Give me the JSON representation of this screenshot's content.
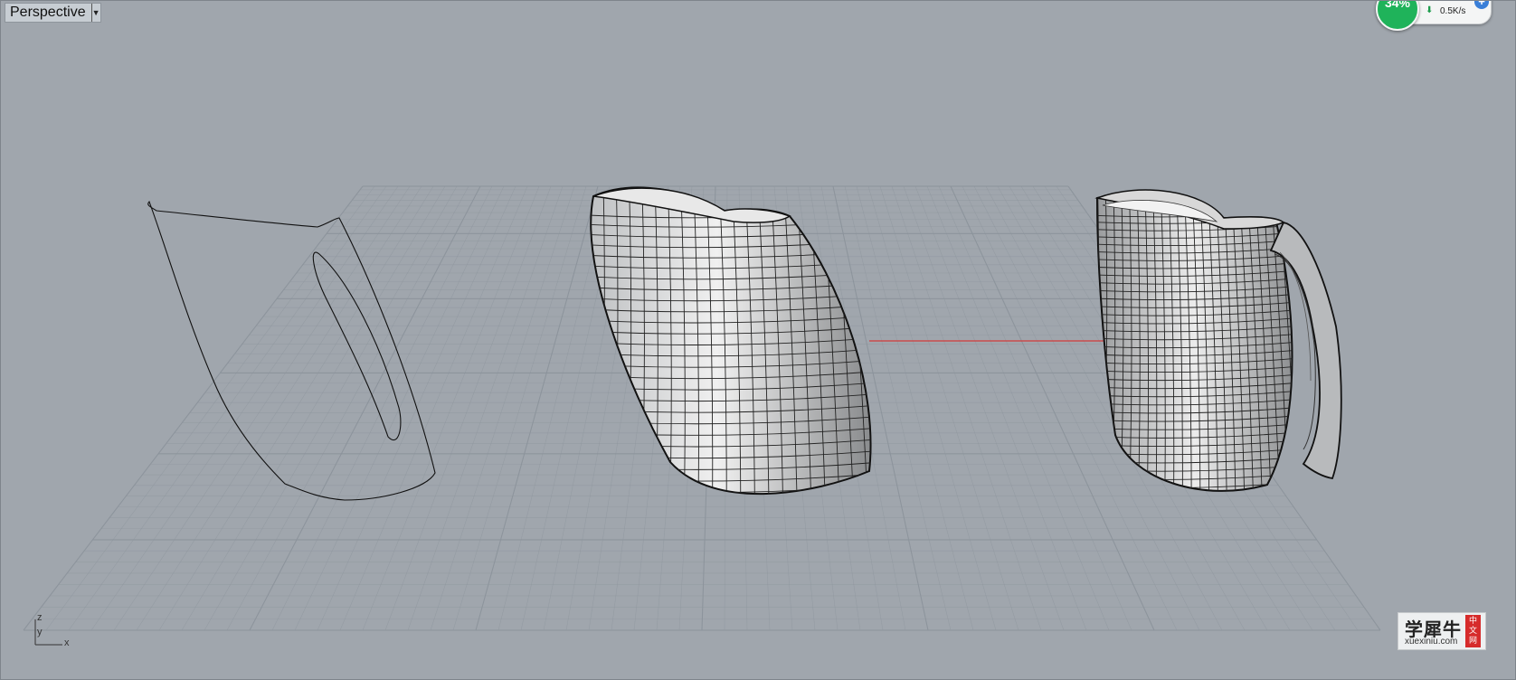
{
  "viewport": {
    "title": "Perspective",
    "dropdown_icon": "triangle-down-icon"
  },
  "network_widget": {
    "percent": "34%",
    "speed": "0.5K/s",
    "down_icon": "down-arrow-icon",
    "add_icon": "plus-icon"
  },
  "axes": {
    "z": "z",
    "y": "y",
    "x": "x"
  },
  "watermark": {
    "chinese": "学犀牛",
    "url": "xuexiniu.com",
    "badge": [
      "中",
      "文",
      "网"
    ]
  },
  "colors": {
    "background": "#a0a6ad",
    "grid": "#8b939b",
    "x_axis": "#d23a3a",
    "surface": "#d9dadb"
  }
}
